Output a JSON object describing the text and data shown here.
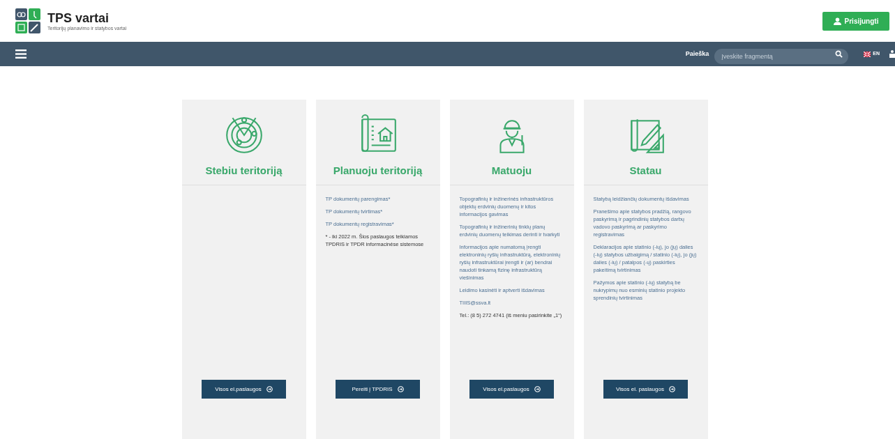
{
  "header": {
    "title": "TPS vartai",
    "subtitle": "Teritorijų planavimo ir statybos vartai",
    "login_button": "Prisijungti"
  },
  "navbar": {
    "search_label": "Paieška",
    "search": {
      "placeholder": "Įveskite fragmentą"
    },
    "language": "EN"
  },
  "cards": [
    {
      "kind": "observe",
      "title": "Stebiu teritoriją",
      "button": "Visos el.paslaugos"
    },
    {
      "kind": "plan",
      "title": "Planuoju teritoriją",
      "items": [
        {
          "kind": "link",
          "text": "TP dokumentų parengimas*"
        },
        {
          "kind": "link",
          "text": "TP dokumentų tvirtimas*"
        },
        {
          "kind": "link",
          "text": "TP dokumentų registravimas*"
        },
        {
          "kind": "note",
          "text": "* - iki 2022 m. Šios paslaugos teikiamos TPDRIS ir TPDR informacinėse sistemose"
        }
      ],
      "button": "Pereiti į TPDRIS"
    },
    {
      "kind": "measure",
      "title": "Matuoju",
      "items": [
        {
          "kind": "link",
          "text": "Topografinių ir inžinerinės infrastruktūros objektų erdvinių duomenų ir kitos informacijos gavimas"
        },
        {
          "kind": "link",
          "text": "Topografinių ir inžinerinių tinklų planų erdvinių duomenų teikimas derinti ir tvarkyti"
        },
        {
          "kind": "link",
          "text": "Informacijos apie numatomą įrengti elektroninių ryšių infrastruktūrą, elektroninių ryšių infrastruktūrai įrengti ir (ar) bendrai naudoti tinkamą fizinę infrastruktūrą viešinimas"
        },
        {
          "kind": "link",
          "text": "Leidimo kasinėti ir aptverti išdavimas"
        },
        {
          "kind": "link",
          "text": "TIIIS@ssva.lt"
        },
        {
          "kind": "note",
          "text": "Tel.: (8 5) 272 4741 (iš meniu pasirinkite „1“)"
        }
      ],
      "button": "Visos el.paslaugos"
    },
    {
      "kind": "build",
      "title": "Statau",
      "items": [
        {
          "kind": "link",
          "text": "Statybą leidžiančių dokumentų išdavimas"
        },
        {
          "kind": "link",
          "text": "Pranešimo apie statybos pradžią, rangovo paskyrimą ir pagrindinių statybos darbų vadovo paskyrimą ar paskyrimo registravimas"
        },
        {
          "kind": "link",
          "text": "Deklaracijos apie statinio (-ių), jo (jų) dalies (-ių) statybos užbaigimą / statinio (-ių), jo (jų) dalies (-ių) / patalpos (-ų) paskirties pakeitimą tvirtinimas"
        },
        {
          "kind": "link",
          "text": "Pažymos apie statinio (-ių) statybą be nukrypimų nuo esminių statinio projekto sprendinių tvirtinimas"
        }
      ],
      "button": "Visos el. paslaugos"
    }
  ]
}
